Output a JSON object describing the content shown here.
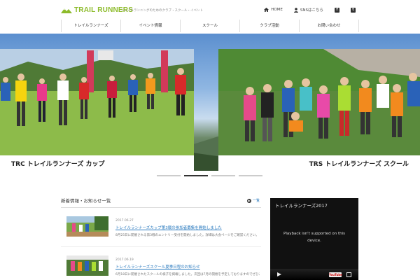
{
  "header": {
    "logo_primary": "TRAIL",
    "logo_secondary": "RUNNERS",
    "tagline": "トレイルランニングのためのクラブ・スクール・イベント",
    "home_label": "HOME",
    "sns_label": "SNSはこちら",
    "facebook_glyph": "f",
    "twitter_glyph": "t"
  },
  "nav": [
    {
      "label": "トレイルランナーズ"
    },
    {
      "label": "イベント情報"
    },
    {
      "label": "スクール"
    },
    {
      "label": "クラブ活動"
    },
    {
      "label": "お問い合わせ"
    }
  ],
  "hero": {
    "slides": [
      {
        "caption": "TRC トレイルランナーズ カップ"
      },
      {
        "caption": "TRS トレイルランナーズ スクール"
      }
    ],
    "active_index": 1
  },
  "news": {
    "heading": "新着情報・お知らせ一覧",
    "more_label": "一覧",
    "items": [
      {
        "date": "2017.06.27",
        "title": "トレイルランナーズカップ第3戦の参加者募集を開始しました",
        "desc": "8月25日に開催される第3戦のエントリー受付を開始しました。詳細は大会ページをご確認ください。"
      },
      {
        "date": "2017.06.19",
        "title": "トレイルランナーズスクール夏季日程のお知らせ",
        "desc": "6月18日に開催されたスクールの様子を掲載しました。次回は7月の開催を予定しておりますのでぜひご参加ください。"
      }
    ]
  },
  "video": {
    "title": "トレイルランナーズ2017",
    "message": "Playback isn't supported on this device.",
    "youtube_label": "YouTube"
  },
  "colors": {
    "brand_green": "#8dbb2b",
    "link_blue": "#2a7abf"
  }
}
